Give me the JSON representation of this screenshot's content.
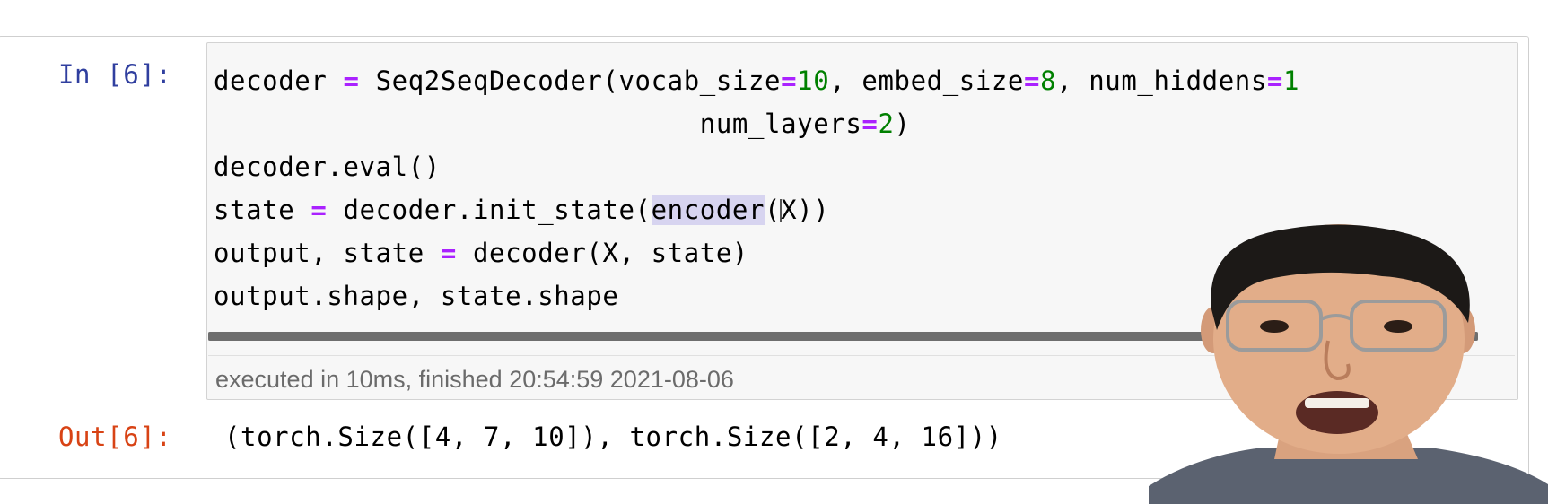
{
  "cell": {
    "in_prompt": "In [6]:",
    "out_prompt": "Out[6]:",
    "code_lines": [
      "decoder = Seq2SeqDecoder(vocab_size=10, embed_size=8, num_hiddens=1",
      "                         num_layers=2)",
      "decoder.eval()",
      "state = decoder.init_state(encoder(X))",
      "output, state = decoder(X, state)",
      "output.shape, state.shape"
    ],
    "execution_info": "executed in 10ms, finished 20:54:59 2021-08-06",
    "output": "(torch.Size([4, 7, 10]), torch.Size([2, 4, 16]))"
  },
  "tokens": {
    "l1": {
      "a": "decoder ",
      "eq": "=",
      "b": " Seq2SeqDecoder(vocab_size",
      "eq2": "=",
      "n1": "10",
      "c": ", embed_size",
      "eq3": "=",
      "n2": "8",
      "d": ", num_hiddens",
      "eq4": "=",
      "n3": "1"
    },
    "l2": {
      "indent": "                              ",
      "a": "num_layers",
      "eq": "=",
      "n": "2",
      "b": ")"
    },
    "l3": {
      "a": "decoder.eval()"
    },
    "l4": {
      "a": "state ",
      "eq": "=",
      "b": " decoder.init_state(",
      "hl": "encoder",
      "c": "(",
      "d": "X))"
    },
    "l5": {
      "a": "output, state ",
      "eq": "=",
      "b": " decoder(X, state)"
    },
    "l6": {
      "a": "output.shape, state.shape"
    }
  },
  "colors": {
    "in_prompt": "#303f9f",
    "out_prompt": "#d84315",
    "operator": "#aa22ff",
    "number": "#008000",
    "highlight": "#d7d4f0",
    "cell_background": "#f7f7f7"
  },
  "overlay": {
    "type": "presenter-webcam",
    "icon": "person-icon"
  }
}
